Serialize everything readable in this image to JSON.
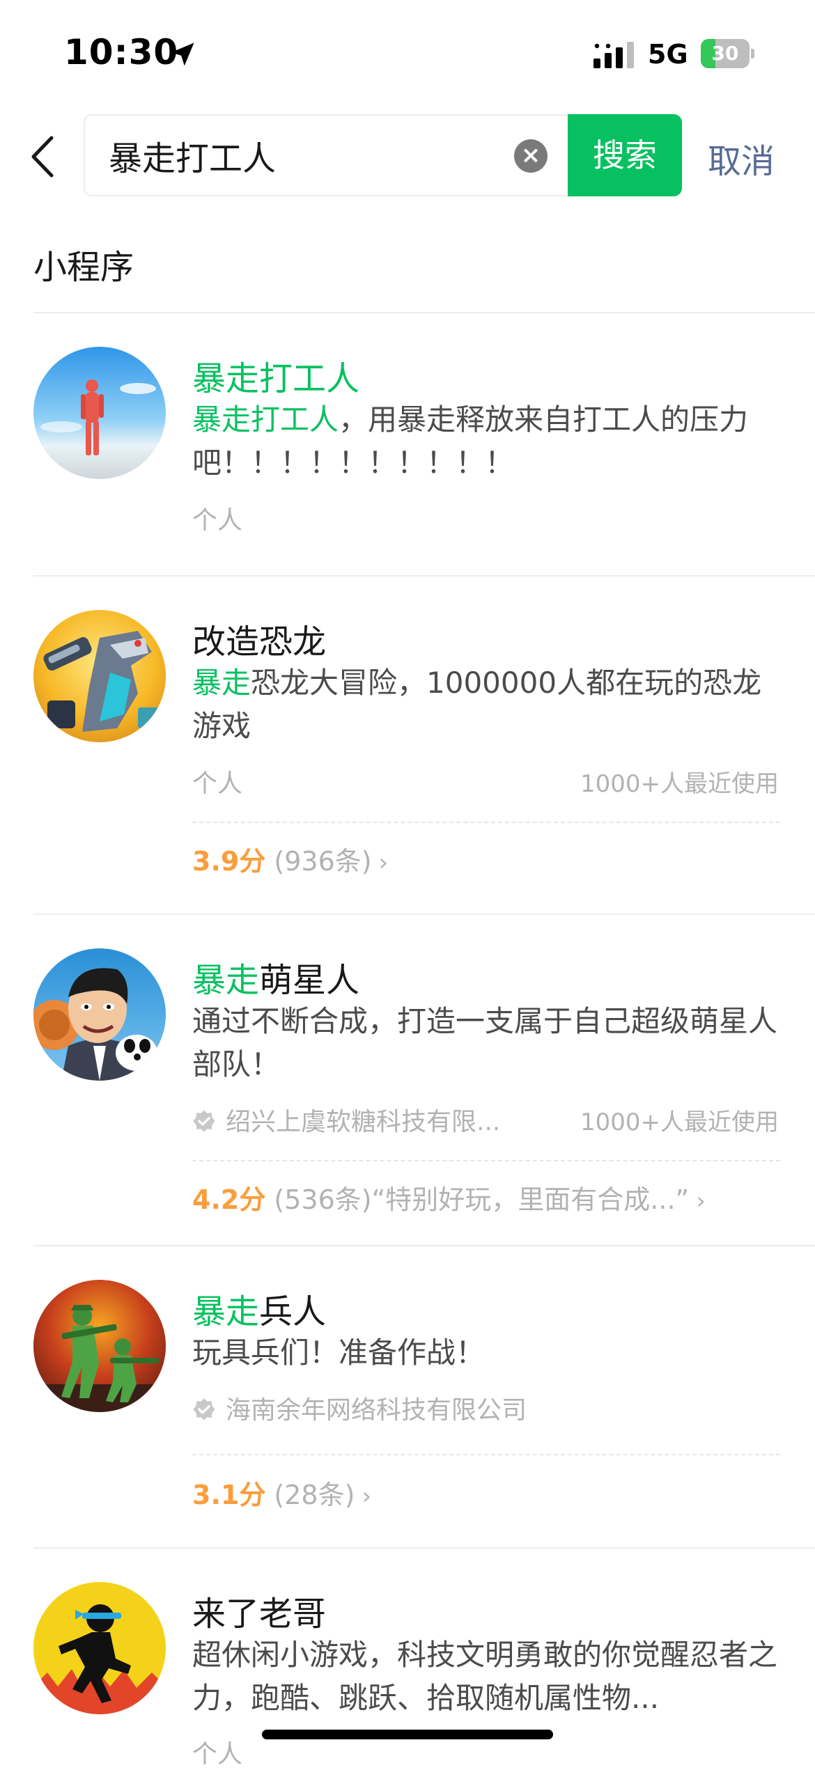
{
  "status_bar": {
    "time": "10:30",
    "network": "5G",
    "battery_level": 30,
    "battery_text": "30",
    "icons": [
      "location-arrow-icon",
      "cellular-signal-icon",
      "battery-charging-icon"
    ]
  },
  "search": {
    "query": "暴走打工人",
    "search_button": "搜索",
    "cancel_button": "取消",
    "clear_glyph": "×"
  },
  "section": {
    "title": "小程序"
  },
  "colors": {
    "accent_green": "#07c160",
    "link_blue": "#576b95",
    "score_orange": "#fa9d3b"
  },
  "results": [
    {
      "title_highlight": "暴走打工人",
      "title_rest": "",
      "desc_highlight": "暴走打工人",
      "desc_rest": "，用暴走释放来自打工人的压力吧！！！！！！！！！！",
      "owner": "个人"
    },
    {
      "title_highlight": "",
      "title_rest": "改造恐龙",
      "desc_highlight": "暴走",
      "desc_rest": "恐龙大冒险，1000000人都在玩的恐龙游戏",
      "owner": "个人",
      "usage": "1000+人最近使用",
      "score": "3.9分",
      "reviews": "(936条)"
    },
    {
      "title_highlight": "暴走",
      "title_rest": "萌星人",
      "desc_highlight": "",
      "desc_rest": "通过不断合成，打造一支属于自己超级萌星人部队！",
      "owner": "绍兴上虞软糖科技有限...",
      "usage": "1000+人最近使用",
      "score": "4.2分",
      "reviews": "(536条)",
      "quote": "“特别好玩，里面有合成...”"
    },
    {
      "title_highlight": "暴走",
      "title_rest": "兵人",
      "desc_highlight": "",
      "desc_rest": "玩具兵们！准备作战！",
      "owner": "海南余年网络科技有限公司",
      "score": "3.1分",
      "reviews": "(28条)"
    },
    {
      "title_highlight": "",
      "title_rest": "来了老哥",
      "desc_highlight": "",
      "desc_rest": "超休闲小游戏，科技文明勇敢的你觉醒忍者之力，跑酷、跳跃、拾取随机属性物...",
      "owner": "个人"
    }
  ],
  "chevron_glyph": "›"
}
